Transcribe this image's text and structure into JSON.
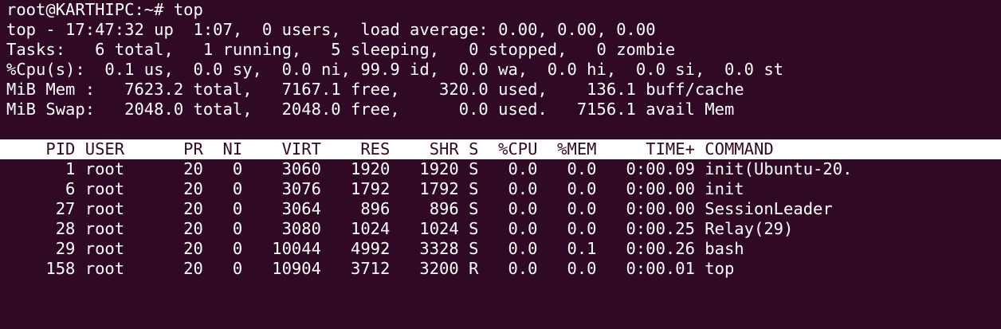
{
  "terminal": {
    "prompt_line": "root@KARTHIPC:~# top",
    "summary": [
      "top - 17:47:32 up  1:07,  0 users,  load average: 0.00, 0.00, 0.00",
      "Tasks:   6 total,   1 running,   5 sleeping,   0 stopped,   0 zombie",
      "%Cpu(s):  0.1 us,  0.0 sy,  0.0 ni, 99.9 id,  0.0 wa,  0.0 hi,  0.0 si,  0.0 st",
      "MiB Mem :   7623.2 total,   7167.1 free,    320.0 used,    136.1 buff/cache",
      "MiB Swap:   2048.0 total,   2048.0 free,      0.0 used.   7156.1 avail Mem"
    ],
    "process_header": "    PID USER      PR  NI    VIRT    RES    SHR S  %CPU  %MEM     TIME+ COMMAND",
    "processes": [
      "      1 root      20   0    3060   1920   1920 S   0.0   0.0   0:00.09 init(Ubuntu-20.",
      "      6 root      20   0    3076   1792   1792 S   0.0   0.0   0:00.00 init",
      "     27 root      20   0    3064    896    896 S   0.0   0.0   0:00.00 SessionLeader",
      "     28 root      20   0    3080   1024   1024 S   0.0   0.0   0:00.25 Relay(29)",
      "     29 root      20   0   10044   4992   3328 S   0.0   0.1   0:00.26 bash",
      "    158 root      20   0   10904   3712   3200 R   0.0   0.0   0:00.01 top"
    ]
  }
}
